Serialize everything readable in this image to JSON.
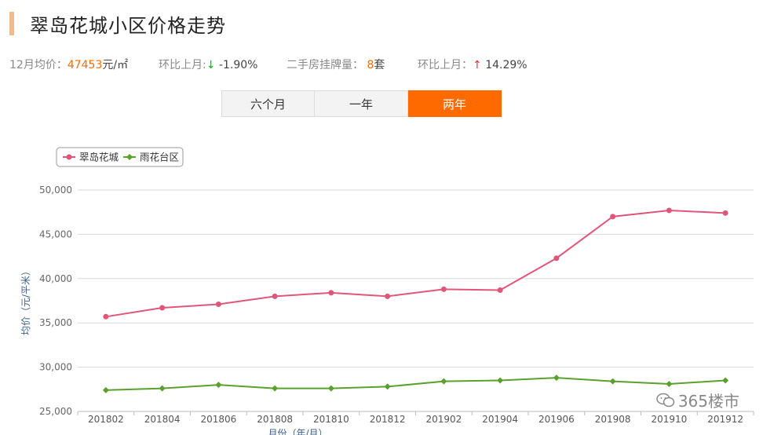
{
  "title": "翠岛花城小区价格走势",
  "stats": {
    "avg_label": "12月均价：",
    "avg_value": "47453",
    "avg_unit": "元/㎡",
    "mom_label": "环比上月:",
    "mom_arrow": "↓",
    "mom_value": "-1.90%",
    "listing_label": "二手房挂牌量：",
    "listing_value": "8",
    "listing_unit": "套",
    "mom2_label": "环比上月：",
    "mom2_arrow": "↑",
    "mom2_value": "14.29%"
  },
  "tabs": [
    "六个月",
    "一年",
    "两年"
  ],
  "active_tab": 2,
  "watermark": "365楼市",
  "chart_data": {
    "type": "line",
    "categories": [
      "201802",
      "201804",
      "201806",
      "201808",
      "201810",
      "201812",
      "201902",
      "201904",
      "201906",
      "201908",
      "201910",
      "201912"
    ],
    "series": [
      {
        "name": "翠岛花城",
        "color": "#e0567a",
        "marker": "circle",
        "values": [
          35700,
          36700,
          37100,
          38000,
          38400,
          38000,
          38800,
          38700,
          42300,
          47000,
          47700,
          47400
        ]
      },
      {
        "name": "雨花台区",
        "color": "#5aa02c",
        "marker": "diamond",
        "values": [
          27400,
          27600,
          28000,
          27600,
          27600,
          27800,
          28400,
          28500,
          28800,
          28400,
          28100,
          28500
        ]
      }
    ],
    "ylim": [
      25000,
      50000
    ],
    "yticks": [
      "25,000",
      "30,000",
      "35,000",
      "40,000",
      "45,000",
      "50,000"
    ],
    "ylabel": "均价（元/平米）",
    "xlabel": "月份（年/月）",
    "legend": "top-left",
    "grid": true
  }
}
